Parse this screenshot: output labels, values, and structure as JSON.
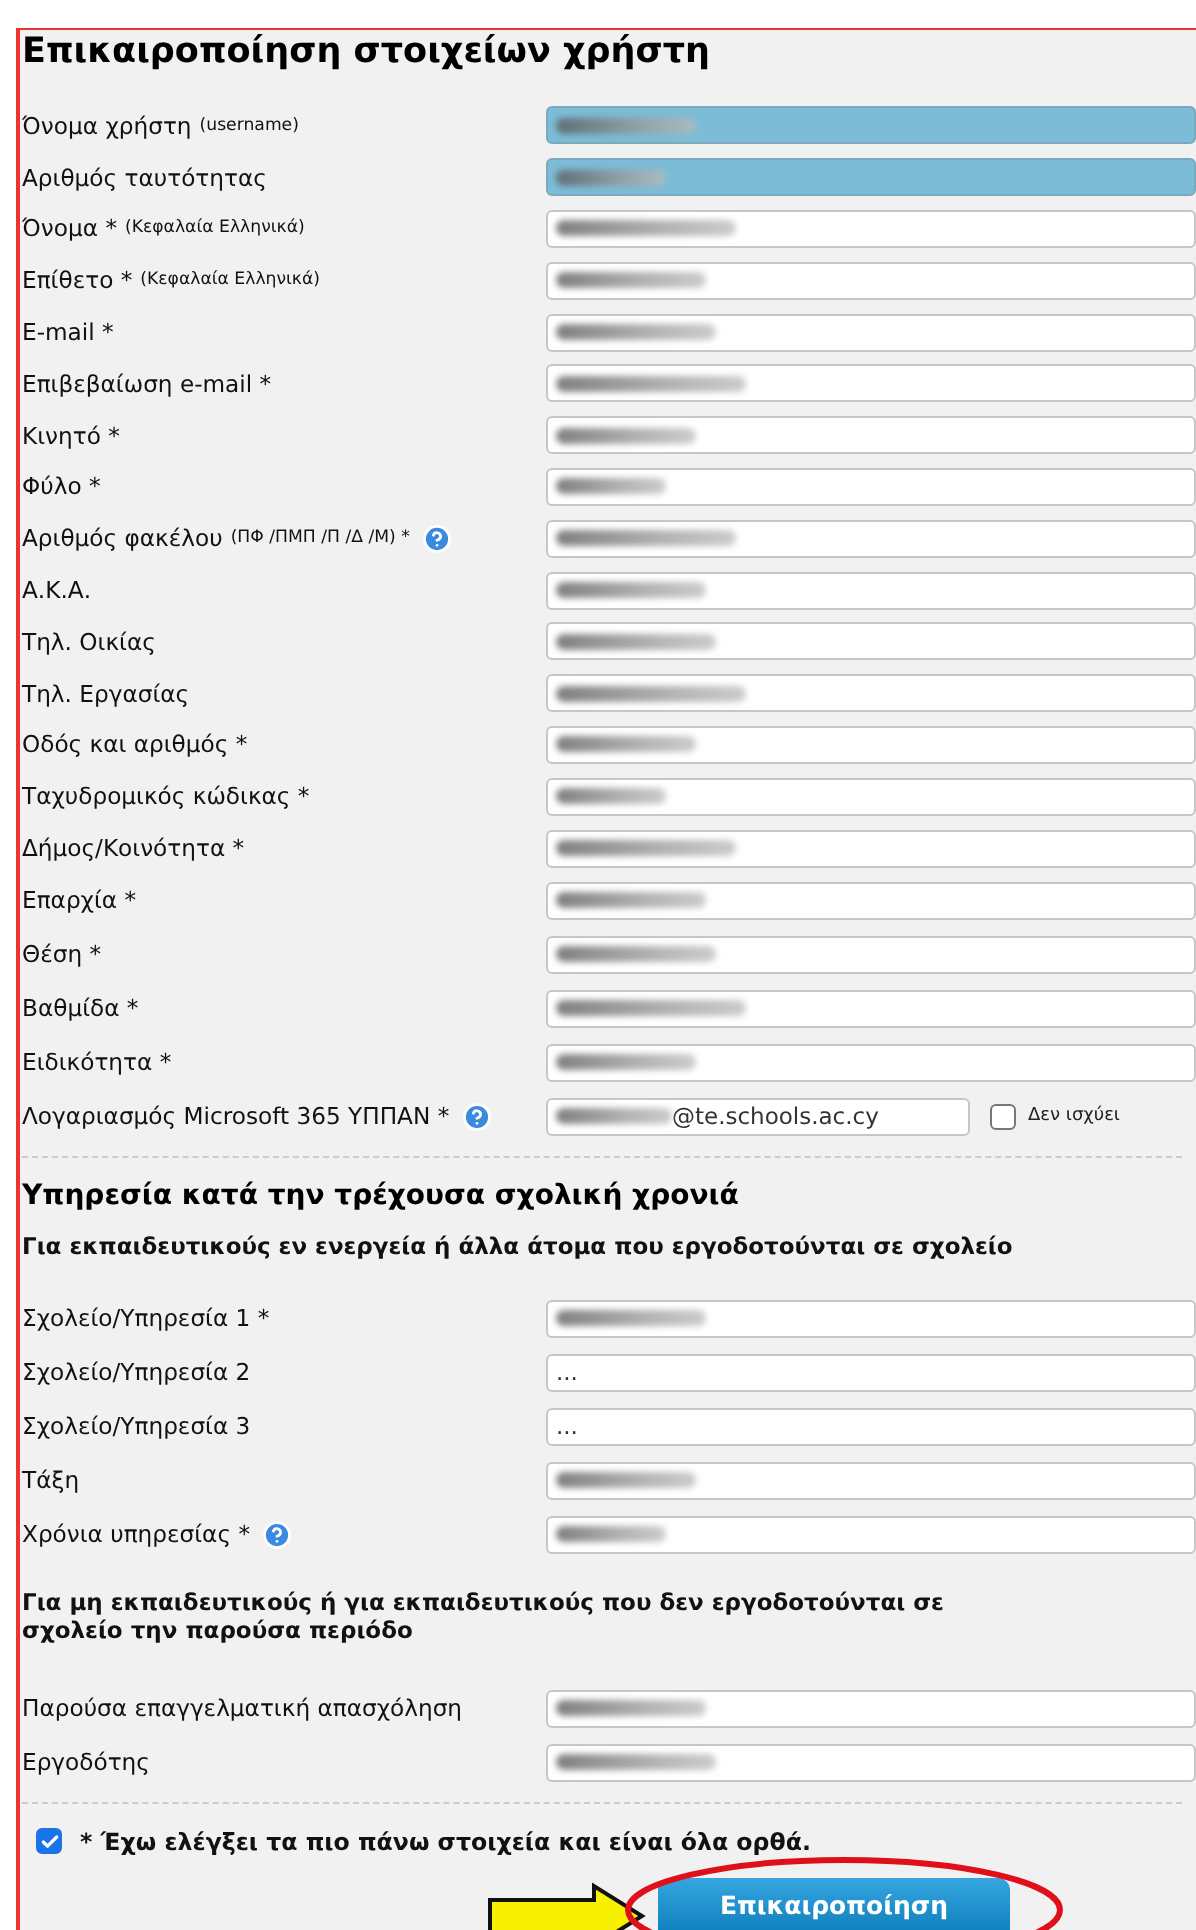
{
  "title": "Επικαιροποίηση στοιχείων χρήστη",
  "fields": [
    {
      "label": "Όνομα χρήστη",
      "note": "(username)",
      "kind": "readonly",
      "redacted": true
    },
    {
      "label": "Αριθμός ταυτότητας",
      "kind": "readonly",
      "redacted": true
    },
    {
      "label": "Όνομα *",
      "note": "(Κεφαλαία Ελληνικά)",
      "kind": "text",
      "redacted": true
    },
    {
      "label": "Επίθετο *",
      "note": "(Κεφαλαία Ελληνικά)",
      "kind": "text",
      "redacted": true
    },
    {
      "label": "E-mail *",
      "kind": "text",
      "redacted": true
    },
    {
      "label": "Επιβεβαίωση e-mail *",
      "kind": "text",
      "redacted": true
    },
    {
      "label": "Κινητό *",
      "kind": "text",
      "redacted": true
    },
    {
      "label": "Φύλο *",
      "kind": "text",
      "redacted": true
    },
    {
      "label": "Αριθμός φακέλου",
      "note": "(ΠΦ /ΠΜΠ /Π /Δ /Μ) *",
      "kind": "text",
      "help": true,
      "redacted": true
    },
    {
      "label": "Α.Κ.Α.",
      "kind": "text",
      "redacted": true
    },
    {
      "label": "Τηλ. Οικίας",
      "kind": "text",
      "redacted": true
    },
    {
      "label": "Τηλ. Εργασίας",
      "kind": "text",
      "redacted": true
    },
    {
      "label": "Οδός και αριθμός *",
      "kind": "text",
      "redacted": true
    },
    {
      "label": "Ταχυδρομικός κώδικας *",
      "kind": "text",
      "redacted": true
    },
    {
      "label": "Δήμος/Κοινότητα *",
      "kind": "text",
      "redacted": true
    },
    {
      "label": "Επαρχία *",
      "kind": "text",
      "redacted": true
    },
    {
      "label": "Θέση *",
      "kind": "text",
      "redacted": true
    },
    {
      "label": "Βαθμίδα *",
      "kind": "text",
      "redacted": true
    },
    {
      "label": "Ειδικότητα *",
      "kind": "text",
      "redacted": true
    },
    {
      "label": "Λογαριασμός Microsoft 365 ΥΠΠΑΝ *",
      "kind": "with_option",
      "help": true,
      "redacted": true,
      "value": "@te.schools.ac.cy",
      "option": {
        "label": "Δεν ισχύει",
        "checked": false
      }
    }
  ],
  "service_section": {
    "heading": "Υπηρεσία κατά την τρέχουσα σχολική χρονιά",
    "groups": [
      {
        "heading": "Για εκπαιδευτικούς εν ενεργεία ή άλλα άτομα που εργοδοτούνται σε σχολείο",
        "fields": [
          {
            "label": "Σχολείο/Υπηρεσία 1 *",
            "kind": "text",
            "redacted": true
          },
          {
            "label": "Σχολείο/Υπηρεσία 2",
            "kind": "text",
            "value": "..."
          },
          {
            "label": "Σχολείο/Υπηρεσία 3",
            "kind": "text",
            "value": "..."
          },
          {
            "label": "Τάξη",
            "kind": "text",
            "redacted": true
          },
          {
            "label": "Χρόνια υπηρεσίας *",
            "kind": "text",
            "help": true,
            "redacted": true
          }
        ]
      },
      {
        "heading": "Για μη εκπαιδευτικούς ή για εκπαιδευτικούς που δεν εργοδοτούνται σε σχολείο την παρούσα περιόδο",
        "fields": [
          {
            "label": "Παρούσα επαγγελματική απασχόληση",
            "kind": "text",
            "redacted": true
          },
          {
            "label": "Εργοδότης",
            "kind": "text",
            "redacted": true
          }
        ]
      }
    ]
  },
  "confirmation": {
    "label": "* Έχω ελέγξει τα πιο πάνω στοιχεία και είναι όλα ορθά.",
    "checked": true
  },
  "submit_button": {
    "label": "Επικαιροποίηση",
    "highlighted": true
  }
}
